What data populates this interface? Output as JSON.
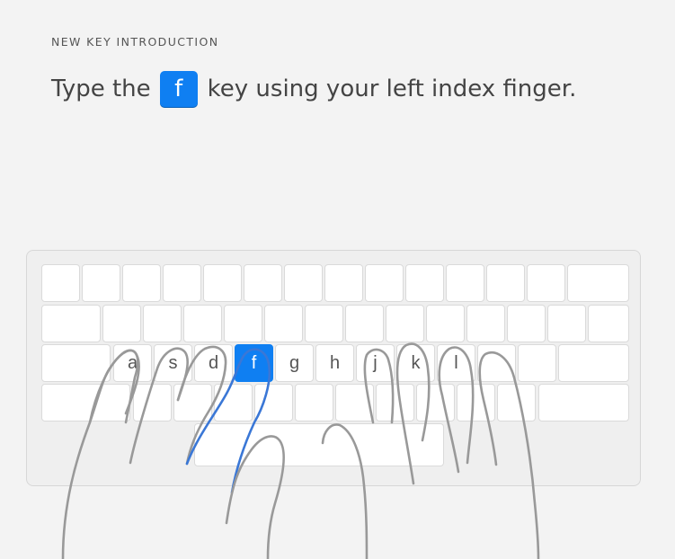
{
  "lesson": {
    "eyebrow": "NEW KEY INTRODUCTION",
    "instruction_prefix": "Type the",
    "target_key": "f",
    "instruction_suffix": "key using your left index finger."
  },
  "keyboard": {
    "home_row_letters": [
      "a",
      "s",
      "d",
      "f",
      "g",
      "h",
      "j",
      "k",
      "l"
    ],
    "active_key": "f"
  },
  "colors": {
    "accent": "#0f7ff2",
    "background": "#f3f3f3",
    "hand_outline": "#999999"
  }
}
